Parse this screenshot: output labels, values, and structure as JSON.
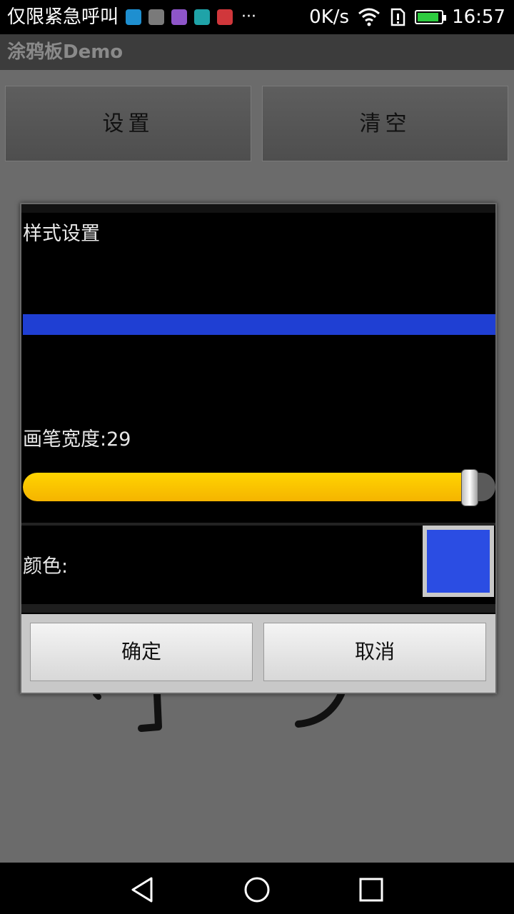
{
  "status_bar": {
    "notification": "仅限紧急呼叫",
    "icons": [
      "usb-icon",
      "image-icon",
      "keyboard-icon",
      "shield-icon",
      "huawei-icon"
    ],
    "icon_colors": [
      "#1e8fd0",
      "#7a7a7a",
      "#8e55c9",
      "#1fa3a8",
      "#d0373b"
    ],
    "overflow": "···",
    "net_speed": "0K/s",
    "time": "16:57",
    "battery_level": 0.9
  },
  "app": {
    "title": "涂鸦板Demo",
    "settings_button": "设置",
    "clear_button": "清空"
  },
  "dialog": {
    "title": "样式设置",
    "preview_color": "#1f3fd3",
    "width_label": "画笔宽度:29",
    "slider_value": 0.945,
    "color_label": "颜色:",
    "selected_color": "#2b4de3",
    "confirm_button": "确定",
    "cancel_button": "取消"
  },
  "nav": {
    "icons": [
      "back-icon",
      "home-icon",
      "recents-icon"
    ]
  }
}
